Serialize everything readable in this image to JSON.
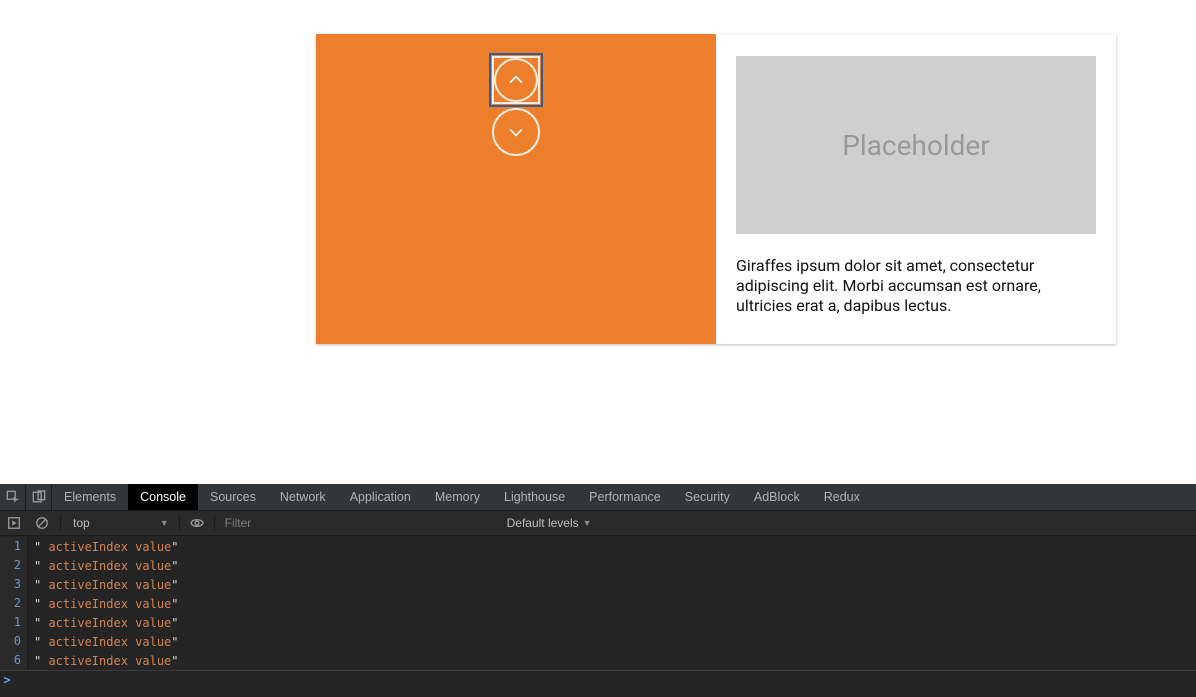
{
  "card": {
    "placeholder_label": "Placeholder",
    "body_text": "Giraffes ipsum dolor sit amet, consectetur adipiscing elit. Morbi accumsan est ornare, ultricies erat a, dapibus lectus.",
    "accent_color": "#ed7f2c"
  },
  "devtools": {
    "tabs": [
      "Elements",
      "Console",
      "Sources",
      "Network",
      "Application",
      "Memory",
      "Lighthouse",
      "Performance",
      "Security",
      "AdBlock",
      "Redux"
    ],
    "active_tab": "Console",
    "context": "top",
    "filter_placeholder": "Filter",
    "levels_label": "Default levels",
    "log": [
      {
        "n": 1,
        "msg": " activeIndex value"
      },
      {
        "n": 2,
        "msg": " activeIndex value"
      },
      {
        "n": 3,
        "msg": " activeIndex value"
      },
      {
        "n": 2,
        "msg": " activeIndex value"
      },
      {
        "n": 1,
        "msg": " activeIndex value"
      },
      {
        "n": 0,
        "msg": " activeIndex value"
      },
      {
        "n": 6,
        "msg": " activeIndex value"
      }
    ]
  }
}
